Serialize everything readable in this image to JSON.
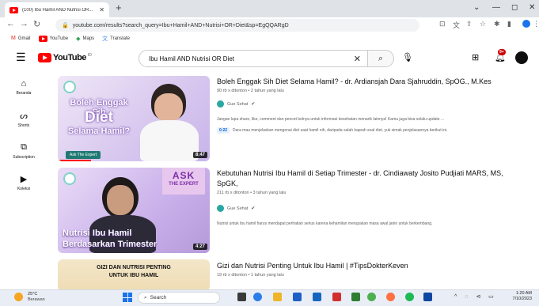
{
  "browser": {
    "tab_title": "(100) Ibu Hamil AND Nutrisi OR...",
    "url": "youtube.com/results?search_query=Ibu+Hamil+AND+Nutrisi+OR+Diet&sp=EgQQARgD",
    "bookmarks": [
      {
        "label": "Gmail",
        "icon": "gmail-icon"
      },
      {
        "label": "YouTube",
        "icon": "youtube-icon"
      },
      {
        "label": "Maps",
        "icon": "maps-icon"
      },
      {
        "label": "Translate",
        "icon": "translate-icon"
      }
    ]
  },
  "youtube": {
    "logo_text": "YouTube",
    "logo_region": "ID",
    "search_value": "Ibu Hamil AND Nutrisi OR Diet",
    "notifications": "9+",
    "sidebar": [
      {
        "label": "Beranda",
        "icon": "home-icon"
      },
      {
        "label": "Shorts",
        "icon": "shorts-icon"
      },
      {
        "label": "Subscription",
        "icon": "subscriptions-icon"
      },
      {
        "label": "Koleksi",
        "icon": "library-icon"
      }
    ]
  },
  "results": [
    {
      "title": "Boleh Enggak Sih Diet Selama Hamil? - dr. Ardiansjah Dara Sjahruddin, SpOG., M.Kes",
      "meta": "90 rb x ditonton • 2 tahun yang lalu",
      "channel": "Gue Sehat",
      "description": "Jangan lupa share, like, comment dan pencet belnya untuk informasi kesehatan menarik lainnya! Kamu juga bisa selalu update ...",
      "chapter_time": "0:22",
      "chapter_text": "Dara mau menjelaskan mengenai diet saat hamil nih, daripada salah kaprah soal diet, yuk simak penjelasannya berikut ini.",
      "duration": "8:47",
      "thumb_line1": "Boleh Enggak Sih",
      "thumb_line2": "Diet",
      "thumb_line3": "Selama Hamil?",
      "thumb_tag": "Ask The Expert"
    },
    {
      "title": "Kebutuhan Nutrisi Ibu Hamil di Setiap Trimester - dr. Cindiawaty Josito Pudjiati MARS, MS, SpGK,",
      "meta": "211 rb x ditonton • 3 tahun yang lalu",
      "channel": "Gue Sehat",
      "description": "Nutrisi untuk ibu hamil harus mendapat perhatian serius karena kehamilan merupakan masa awal janin untuk berkembang.",
      "duration": "4:27",
      "thumb_ask1": "ASK",
      "thumb_ask2": "THE EXPERT",
      "thumb_line1": "Nutrisi Ibu Hamil",
      "thumb_line2": "Berdasarkan Trimester"
    },
    {
      "title": "Gizi dan Nutrisi Penting Untuk Ibu Hamil | #TipsDokterKeven",
      "meta": "19 rb x ditonton • 1 tahun yang lalu",
      "thumb_line1": "GIZI DAN NUTRISI PENTING",
      "thumb_line2": "UNTUK IBU HAMIL"
    }
  ],
  "taskbar": {
    "temp": "25°C",
    "weather": "Berawan",
    "search_label": "Search",
    "time": "1:20 AM",
    "date": "7/10/2023"
  }
}
